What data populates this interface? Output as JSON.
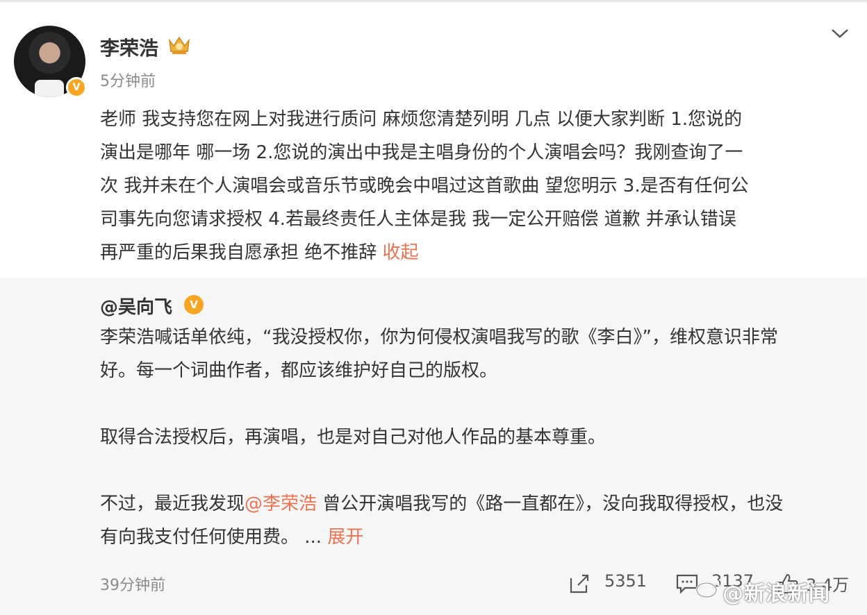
{
  "author": {
    "name": "李荣浩",
    "time": "5分钟前"
  },
  "post": {
    "lines": [
      "老师 我支持您在网上对我进行质问 麻烦您清楚列明 几点  以便大家判断 1.您说的",
      "演出是哪年 哪一场  2.您说的演出中我是主唱身份的个人演唱会吗？我刚查询了一",
      "次 我并未在个人演唱会或音乐节或晚会中唱过这首歌曲 望您明示 3.是否有任何公",
      "司事先向您请求授权  4.若最终责任人主体是我 我一定公开赔偿 道歉 并承认错误",
      "再严重的后果我自愿承担 绝不推辞 "
    ],
    "collapse": "收起"
  },
  "repost": {
    "author": "@吴向飞",
    "p1_line1": "李荣浩喊话单依纯，“我没授权你，你为何侵权演唱我写的歌《李白》”，维权意识非常",
    "p1_line2": "好。每一个词曲作者，都应该维护好自己的版权。",
    "p2": "取得合法授权后，再演唱，也是对自己对他人作品的基本尊重。",
    "p3_pre": "不过，最近我发现",
    "p3_mention": "@李荣浩",
    "p3_post": " 曾公开演唱我写的《路一直都在》，没向我取得授权，也没",
    "p3_line2": "有向我支付任何使用费。  ... ",
    "expand": "展开",
    "time": "39分钟前",
    "reposts": "5351",
    "comments": "3137",
    "likes": "3.4万"
  },
  "watermark": "@新浪新闻",
  "colors": {
    "link": "#eb7350",
    "badge": "#f6a623",
    "repost_bg": "#f6f6f6"
  }
}
